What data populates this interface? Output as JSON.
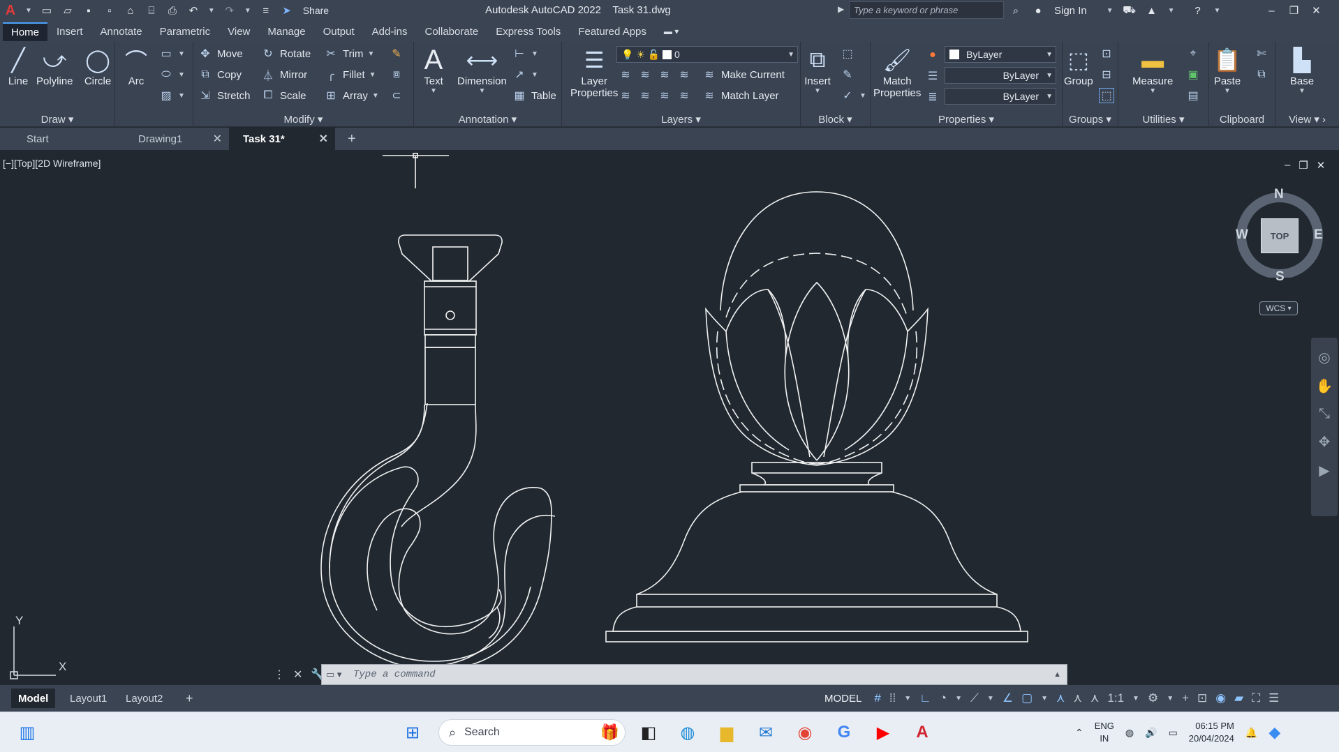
{
  "app": {
    "title": "Autodesk AutoCAD 2022",
    "filename": "Task 31.dwg",
    "logo": "A",
    "share_label": "Share",
    "search_placeholder": "Type a keyword or phrase",
    "sign_in": "Sign In"
  },
  "ribbon_tabs": [
    "Home",
    "Insert",
    "Annotate",
    "Parametric",
    "View",
    "Manage",
    "Output",
    "Add-ins",
    "Collaborate",
    "Express Tools",
    "Featured Apps"
  ],
  "ribbon": {
    "draw": {
      "title": "Draw",
      "line": "Line",
      "polyline": "Polyline",
      "circle": "Circle",
      "arc": "Arc"
    },
    "modify": {
      "title": "Modify",
      "move": "Move",
      "rotate": "Rotate",
      "trim": "Trim",
      "copy": "Copy",
      "mirror": "Mirror",
      "fillet": "Fillet",
      "stretch": "Stretch",
      "scale": "Scale",
      "array": "Array"
    },
    "annotation": {
      "title": "Annotation",
      "text": "Text",
      "dimension": "Dimension",
      "table": "Table"
    },
    "layers": {
      "title": "Layers",
      "layer_properties_1": "Layer",
      "layer_properties_2": "Properties",
      "current_layer": "0",
      "make_current": "Make Current",
      "match_layer": "Match Layer"
    },
    "block": {
      "title": "Block",
      "insert": "Insert"
    },
    "properties": {
      "title": "Properties",
      "match_1": "Match",
      "match_2": "Properties",
      "color": "ByLayer",
      "linetype": "ByLayer",
      "lineweight": "ByLayer"
    },
    "groups": {
      "title": "Groups",
      "group": "Group"
    },
    "utilities": {
      "title": "Utilities",
      "measure": "Measure"
    },
    "clipboard": {
      "title": "Clipboard",
      "paste": "Paste"
    },
    "view": {
      "title": "View",
      "base": "Base"
    }
  },
  "doc_tabs": [
    {
      "label": "Start",
      "closable": false,
      "active": false
    },
    {
      "label": "Drawing1",
      "closable": true,
      "active": false
    },
    {
      "label": "Task 31*",
      "closable": true,
      "active": true
    }
  ],
  "viewport": {
    "label": "[−][Top][2D Wireframe]",
    "viewcube": {
      "n": "N",
      "s": "S",
      "e": "E",
      "w": "W",
      "face": "TOP"
    },
    "wcs": "WCS",
    "ucs_x": "X",
    "ucs_y": "Y"
  },
  "command": {
    "placeholder": "Type a command"
  },
  "layout_tabs": [
    "Model",
    "Layout1",
    "Layout2"
  ],
  "status": {
    "model": "MODEL",
    "scale": "1:1"
  },
  "taskbar": {
    "search": "Search",
    "lang_1": "ENG",
    "lang_2": "IN",
    "time": "06:15 PM",
    "date": "20/04/2024"
  },
  "colors": {
    "accent": "#4da3ff",
    "canvas": "#212830",
    "ribbon": "#3a4352",
    "line": "#f2f2f2"
  }
}
